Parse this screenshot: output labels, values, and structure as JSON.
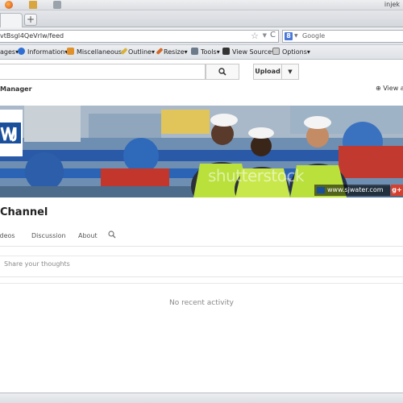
{
  "browser": {
    "user_label": "injek",
    "new_tab_label": "+",
    "url": "vtBsgl4QeVrlw/feed",
    "search_engine_placeholder": "Google",
    "search_engine_letter": "8"
  },
  "bookmarks_toolbar": {
    "items": [
      {
        "label": "ages▾",
        "icon": "none"
      },
      {
        "label": "Information▾",
        "icon": "info-icon"
      },
      {
        "label": "Miscellaneous▾",
        "icon": "misc-icon"
      },
      {
        "label": "Outline▾",
        "icon": "pencil-icon"
      },
      {
        "label": "Resize▾",
        "icon": "resize-icon"
      },
      {
        "label": "Tools▾",
        "icon": "tools-icon"
      },
      {
        "label": "View Source▾",
        "icon": "view-source-icon"
      },
      {
        "label": "Options▾",
        "icon": "options-icon"
      }
    ]
  },
  "header": {
    "upload_label": "Upload",
    "upload_dropdown": "▼",
    "manager_label": "Manager",
    "view_as_label": "View a"
  },
  "banner": {
    "watermark": "shutterstock",
    "website": "www.sjwater.com",
    "gplus": "g+"
  },
  "channel": {
    "title": "Channel",
    "tabs": [
      "Videos",
      "Discussion",
      "About"
    ],
    "share_placeholder": "Share your thoughts",
    "empty_state": "No recent activity"
  },
  "colors": {
    "accent_blue": "#1a4f9c",
    "gplus_red": "#d6402f"
  }
}
